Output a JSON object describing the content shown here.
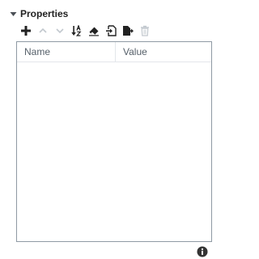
{
  "section": {
    "title": "Properties",
    "expanded": true
  },
  "toolbar": {
    "buttons": [
      {
        "name": "add-property-button",
        "icon": "plus-icon",
        "enabled": true
      },
      {
        "name": "move-up-button",
        "icon": "chevron-up-icon",
        "enabled": false
      },
      {
        "name": "move-down-button",
        "icon": "chevron-down-icon",
        "enabled": false
      },
      {
        "name": "sort-button",
        "icon": "sort-az-icon",
        "enabled": true
      },
      {
        "name": "clear-button",
        "icon": "eraser-icon",
        "enabled": true
      },
      {
        "name": "import-button",
        "icon": "import-icon",
        "enabled": true
      },
      {
        "name": "export-button",
        "icon": "export-icon",
        "enabled": true
      },
      {
        "name": "delete-button",
        "icon": "trash-icon",
        "enabled": false
      }
    ]
  },
  "table": {
    "columns": [
      "Name",
      "Value"
    ],
    "rows": []
  },
  "colors": {
    "icon": "#222222",
    "icon_disabled": "#c2c8ce",
    "border": "#8f9aa4",
    "header_text": "#555f69"
  },
  "footer": {
    "info_icon": "info-icon"
  }
}
